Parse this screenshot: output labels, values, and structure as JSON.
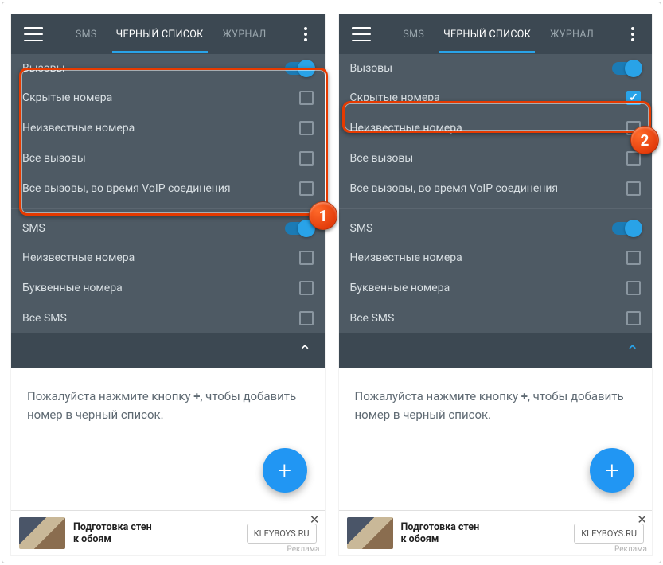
{
  "tabs": {
    "sms": "SMS",
    "blacklist": "ЧЕРНЫЙ СПИСОК",
    "log": "ЖУРНАЛ"
  },
  "calls_section": "Вызовы",
  "sms_section": "SMS",
  "rows": {
    "hidden": "Скрытые номера",
    "unknown": "Неизвестные номера",
    "all_calls": "Все вызовы",
    "voip": "Все вызовы, во время VoIP соединения",
    "unknown_sms": "Неизвестные номера",
    "alpha": "Буквенные номера",
    "all_sms": "Все SMS"
  },
  "hint": {
    "pre": "Пожалуйста нажмите кнопку ",
    "plus": "+",
    "post": ", чтобы добавить номер в черный список."
  },
  "ad": {
    "title1": "Подготовка стен",
    "title2": "к обоям",
    "btn": "KLEYBOYS.RU",
    "label": "Реклама"
  },
  "badges": {
    "one": "1",
    "two": "2"
  }
}
